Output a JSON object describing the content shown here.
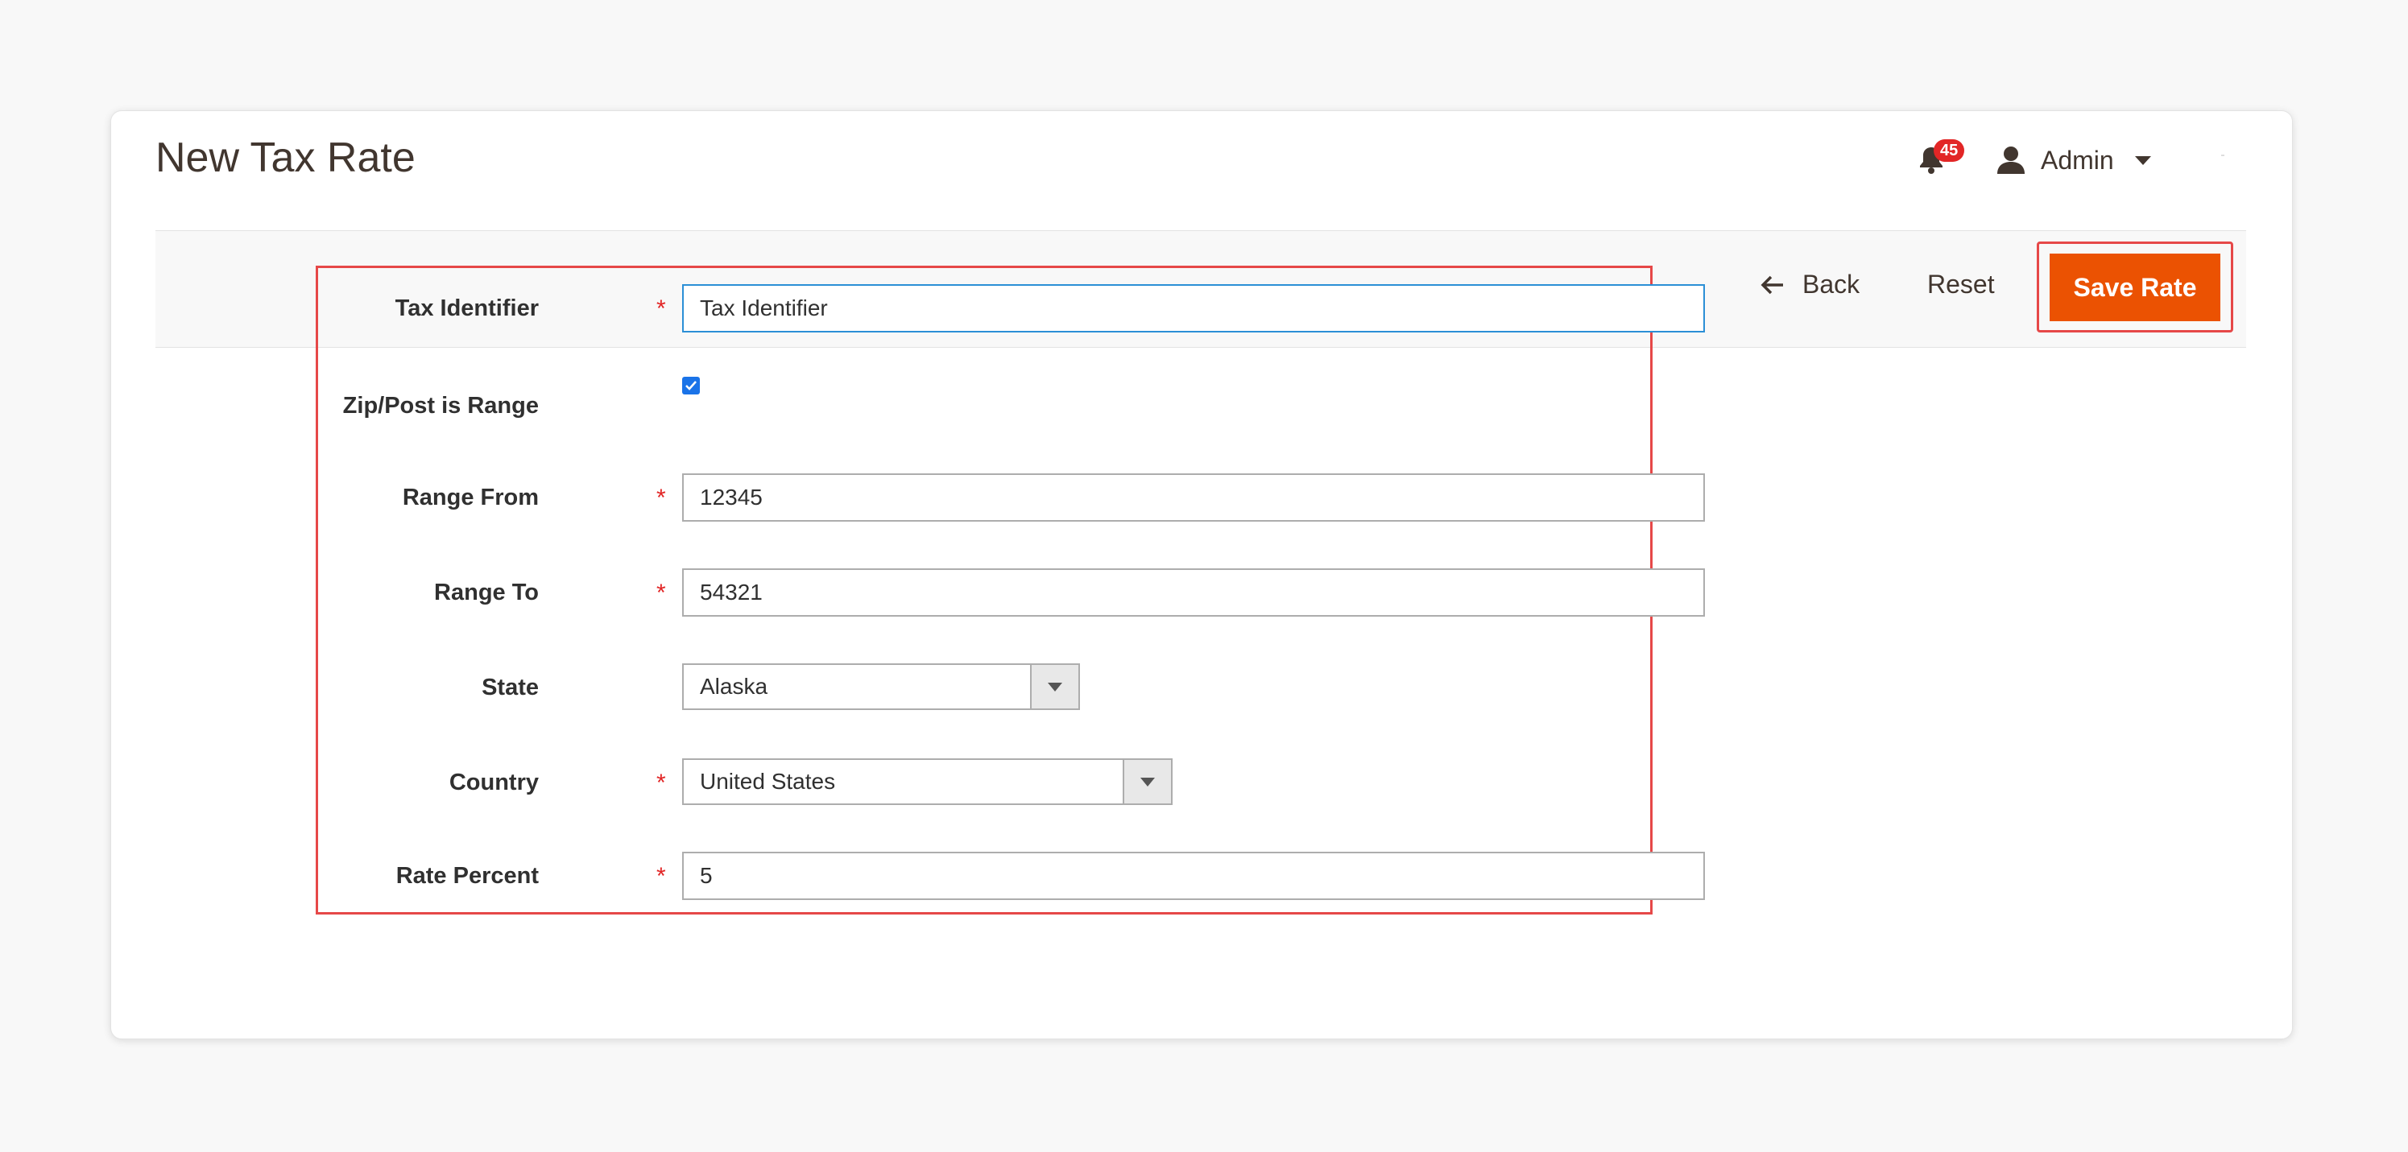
{
  "header": {
    "title": "New Tax Rate",
    "notifications_count": "45",
    "user_name": "Admin"
  },
  "actions": {
    "back_label": "Back",
    "reset_label": "Reset",
    "save_label": "Save Rate"
  },
  "form": {
    "tax_identifier": {
      "label": "Tax Identifier",
      "value": "Tax Identifier",
      "required": true
    },
    "zip_is_range": {
      "label": "Zip/Post is Range",
      "checked": true
    },
    "range_from": {
      "label": "Range From",
      "value": "12345",
      "required": true
    },
    "range_to": {
      "label": "Range To",
      "value": "54321",
      "required": true
    },
    "state": {
      "label": "State",
      "value": "Alaska"
    },
    "country": {
      "label": "Country",
      "value": "United States",
      "required": true
    },
    "rate_percent": {
      "label": "Rate Percent",
      "value": "5",
      "required": true
    },
    "required_mark": "*"
  },
  "colors": {
    "accent": "#eb5202",
    "highlight": "#e64848",
    "required": "#e22626",
    "focus": "#2b8fd6"
  }
}
